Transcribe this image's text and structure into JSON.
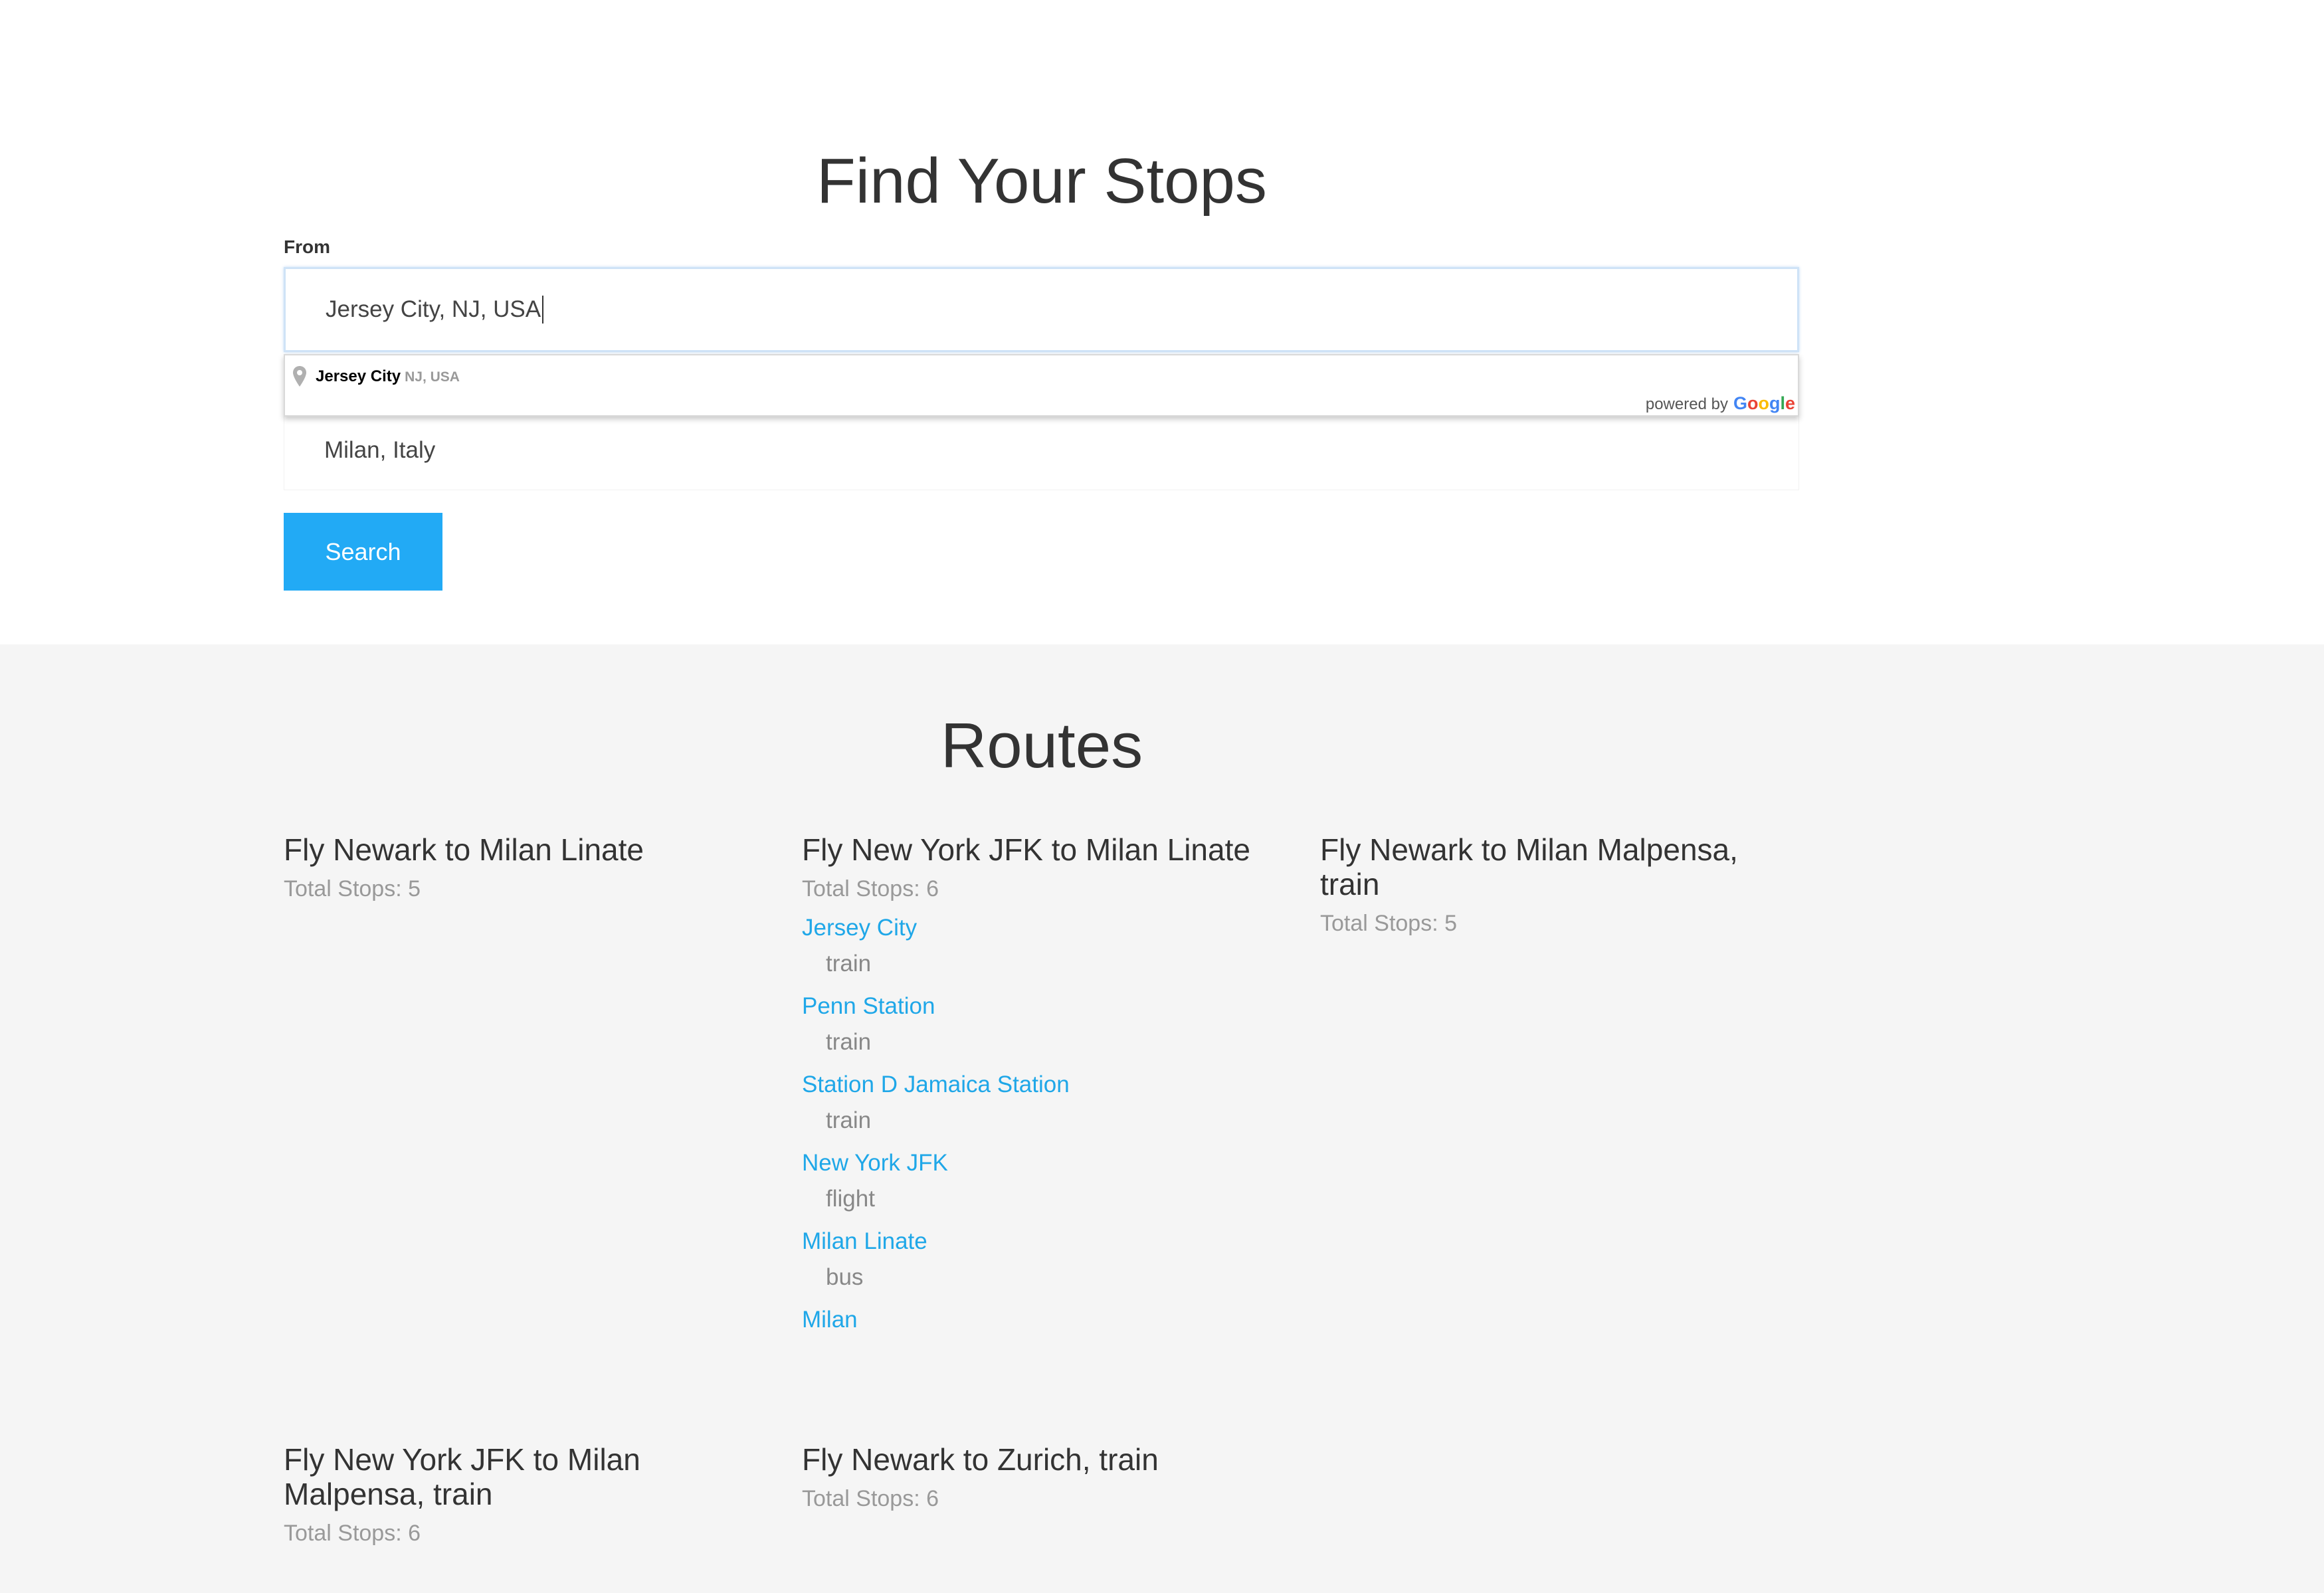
{
  "header": {
    "title": "Find Your Stops"
  },
  "form": {
    "from_label": "From",
    "from_value": "Jersey City, NJ, USA",
    "to_value": "Milan, Italy",
    "search_label": "Search"
  },
  "autocomplete": {
    "suggestion_main": "Jersey City",
    "suggestion_secondary": "NJ, USA",
    "powered_by": "powered by",
    "logo_letters": [
      {
        "letter": "G",
        "color": "#4285F4"
      },
      {
        "letter": "o",
        "color": "#EA4335"
      },
      {
        "letter": "o",
        "color": "#FBBC05"
      },
      {
        "letter": "g",
        "color": "#4285F4"
      },
      {
        "letter": "l",
        "color": "#34A853"
      },
      {
        "letter": "e",
        "color": "#EA4335"
      }
    ]
  },
  "routes": {
    "title": "Routes",
    "items": [
      {
        "title": "Fly Newark to Milan Linate",
        "stops_text": "Total Stops: 5"
      },
      {
        "title": "Fly New York JFK to Milan Linate",
        "stops_text": "Total Stops: 6",
        "stops": [
          {
            "name": "Jersey City",
            "mode": "train"
          },
          {
            "name": "Penn Station",
            "mode": "train"
          },
          {
            "name": "Station D Jamaica Station",
            "mode": "train"
          },
          {
            "name": "New York JFK",
            "mode": "flight"
          },
          {
            "name": "Milan Linate",
            "mode": "bus"
          },
          {
            "name": "Milan",
            "mode": ""
          }
        ]
      },
      {
        "title": "Fly Newark to Milan Malpensa, train",
        "stops_text": "Total Stops: 5"
      },
      {
        "title": "Fly New York JFK to Milan Malpensa, train",
        "stops_text": "Total Stops: 6"
      },
      {
        "title": "Fly Newark to Zurich, train",
        "stops_text": "Total Stops: 6"
      }
    ]
  },
  "colors": {
    "accent": "#22aaf5",
    "link": "#1fa7e8",
    "muted_text": "#999999",
    "section_bg": "#f5f5f5"
  },
  "icons": {
    "pin": "map-pin-icon"
  }
}
